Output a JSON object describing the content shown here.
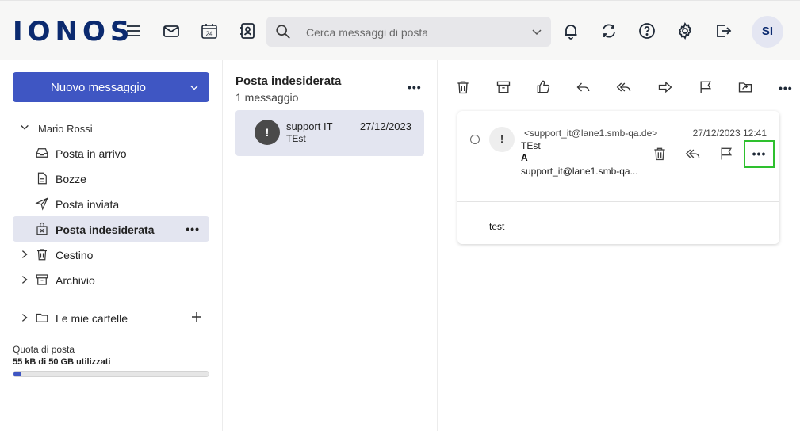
{
  "app": {
    "logo": "IONOS",
    "avatar_initials": "SI"
  },
  "search": {
    "placeholder": "Cerca messaggi di posta"
  },
  "topbar_icons": [
    "menu-icon",
    "mail-icon",
    "calendar-icon",
    "contacts-icon",
    "bell-icon",
    "sync-icon",
    "help-icon",
    "settings-icon",
    "logout-icon"
  ],
  "calendar_day": "24",
  "sidebar": {
    "new_message_label": "Nuovo messaggio",
    "account_name": "Mario Rossi",
    "folders": [
      {
        "label": "Posta in arrivo",
        "icon": "inbox-icon"
      },
      {
        "label": "Bozze",
        "icon": "draft-icon"
      },
      {
        "label": "Posta inviata",
        "icon": "sent-icon"
      },
      {
        "label": "Posta indesiderata",
        "icon": "spam-icon",
        "active": true
      },
      {
        "label": "Cestino",
        "icon": "trash-icon"
      },
      {
        "label": "Archivio",
        "icon": "archive-icon"
      },
      {
        "label": "Le mie cartelle",
        "icon": "folder-icon"
      }
    ],
    "quota_label": "Quota di posta",
    "quota_used": "55 kB di 50 GB utilizzati",
    "quota_fraction": 0.04
  },
  "list": {
    "title": "Posta indesiderata",
    "count": "1 messaggio",
    "messages": [
      {
        "icon_glyph": "!",
        "from": "support IT",
        "date": "27/12/2023",
        "subject": "TEst"
      }
    ]
  },
  "reader": {
    "toolbar_icons": [
      "delete-icon",
      "archive-icon",
      "not-spam-icon",
      "reply-icon",
      "reply-all-icon",
      "forward-icon",
      "flag-icon",
      "move-icon"
    ],
    "message": {
      "icon_glyph": "!",
      "sender_address": "<support_it@lane1.smb-qa.de>",
      "datetime": "27/12/2023 12:41",
      "subject": "TEst",
      "to_label": "A",
      "to_address": "support_it@lane1.smb-qa...",
      "body": "test"
    }
  },
  "colors": {
    "brand": "#0b2a6f",
    "primary": "#3f56c3",
    "active_bg": "#e3e5f0",
    "highlight": "#2ec02e"
  }
}
